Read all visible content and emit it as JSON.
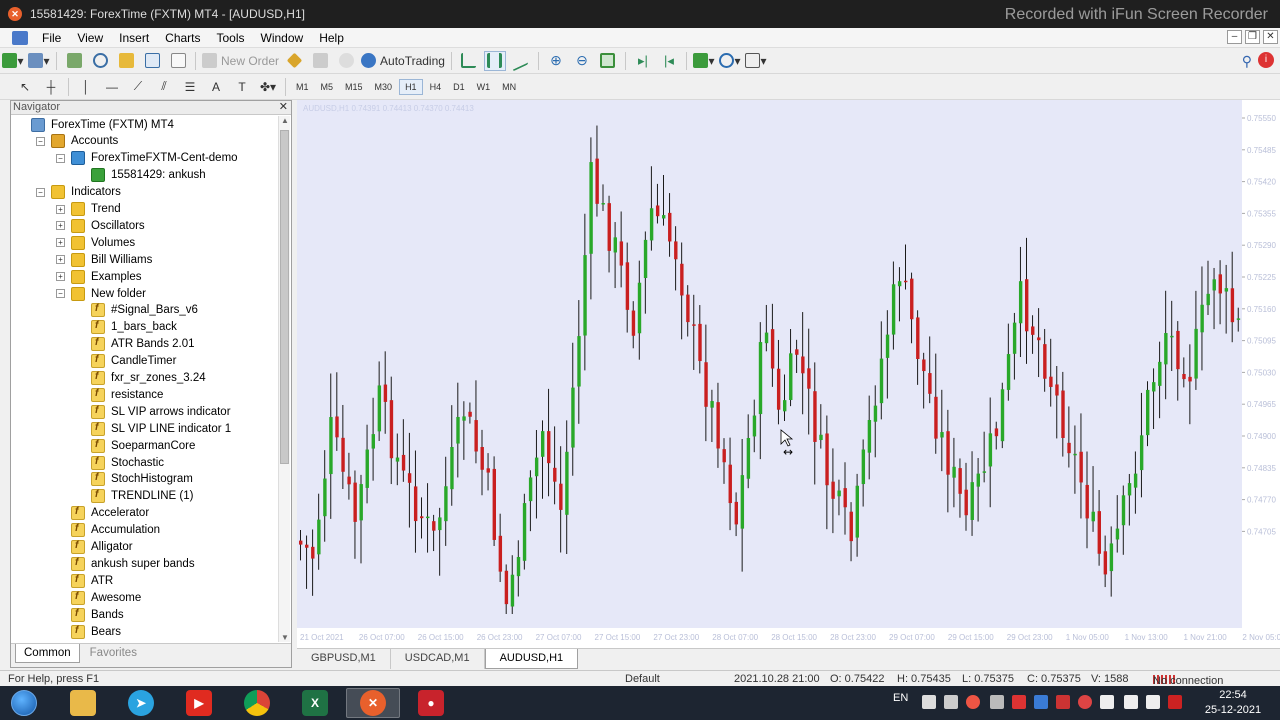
{
  "window": {
    "title": "15581429: ForexTime (FXTM) MT4 - [AUDUSD,H1]",
    "watermark": "Recorded with iFun Screen Recorder"
  },
  "menu": [
    "File",
    "View",
    "Insert",
    "Charts",
    "Tools",
    "Window",
    "Help"
  ],
  "toolbar": {
    "new_order_label": "New Order",
    "autotrading_label": "AutoTrading",
    "timeframes": [
      "M1",
      "M5",
      "M15",
      "M30",
      "H1",
      "H4",
      "D1",
      "W1",
      "MN"
    ],
    "active_timeframe": "H1"
  },
  "navigator": {
    "title": "Navigator",
    "tree": [
      {
        "level": 0,
        "icon": "terminal-icon",
        "label": "ForexTime (FXTM) MT4",
        "expander": ""
      },
      {
        "level": 1,
        "icon": "accounts-icon",
        "label": "Accounts",
        "expander": "−"
      },
      {
        "level": 2,
        "icon": "server-icon",
        "label": "ForexTimeFXTM-Cent-demo",
        "expander": "−"
      },
      {
        "level": 3,
        "icon": "user-icon",
        "label": "15581429: ankush",
        "expander": ""
      },
      {
        "level": 1,
        "icon": "folder-icon",
        "label": "Indicators",
        "expander": "−"
      },
      {
        "level": 2,
        "icon": "folder-icon",
        "label": "Trend",
        "expander": "+"
      },
      {
        "level": 2,
        "icon": "folder-icon",
        "label": "Oscillators",
        "expander": "+"
      },
      {
        "level": 2,
        "icon": "folder-icon",
        "label": "Volumes",
        "expander": "+"
      },
      {
        "level": 2,
        "icon": "folder-icon",
        "label": "Bill Williams",
        "expander": "+"
      },
      {
        "level": 2,
        "icon": "folder-icon",
        "label": "Examples",
        "expander": "+"
      },
      {
        "level": 2,
        "icon": "folder-icon",
        "label": "New folder",
        "expander": "−"
      },
      {
        "level": 3,
        "icon": "indicator-icon",
        "label": "#Signal_Bars_v6",
        "expander": ""
      },
      {
        "level": 3,
        "icon": "indicator-icon",
        "label": "1_bars_back",
        "expander": ""
      },
      {
        "level": 3,
        "icon": "indicator-icon",
        "label": "ATR Bands 2.01",
        "expander": ""
      },
      {
        "level": 3,
        "icon": "indicator-icon",
        "label": "CandleTimer",
        "expander": ""
      },
      {
        "level": 3,
        "icon": "indicator-icon",
        "label": "fxr_sr_zones_3.24",
        "expander": ""
      },
      {
        "level": 3,
        "icon": "indicator-icon",
        "label": "resistance",
        "expander": ""
      },
      {
        "level": 3,
        "icon": "indicator-icon",
        "label": "SL VIP arrows indicator",
        "expander": ""
      },
      {
        "level": 3,
        "icon": "indicator-icon",
        "label": "SL VIP LINE indicator 1",
        "expander": ""
      },
      {
        "level": 3,
        "icon": "indicator-icon",
        "label": "SoeparmanCore",
        "expander": ""
      },
      {
        "level": 3,
        "icon": "indicator-icon",
        "label": "Stochastic",
        "expander": ""
      },
      {
        "level": 3,
        "icon": "indicator-icon",
        "label": "StochHistogram",
        "expander": ""
      },
      {
        "level": 3,
        "icon": "indicator-icon",
        "label": "TRENDLINE (1)",
        "expander": ""
      },
      {
        "level": 2,
        "icon": "indicator-icon",
        "label": "Accelerator",
        "expander": ""
      },
      {
        "level": 2,
        "icon": "indicator-icon",
        "label": "Accumulation",
        "expander": ""
      },
      {
        "level": 2,
        "icon": "indicator-icon",
        "label": "Alligator",
        "expander": ""
      },
      {
        "level": 2,
        "icon": "indicator-icon",
        "label": "ankush super bands",
        "expander": ""
      },
      {
        "level": 2,
        "icon": "indicator-icon",
        "label": "ATR",
        "expander": ""
      },
      {
        "level": 2,
        "icon": "indicator-icon",
        "label": "Awesome",
        "expander": ""
      },
      {
        "level": 2,
        "icon": "indicator-icon",
        "label": "Bands",
        "expander": ""
      },
      {
        "level": 2,
        "icon": "indicator-icon",
        "label": "Bears",
        "expander": ""
      }
    ],
    "tabs": [
      "Common",
      "Favorites"
    ],
    "active_tab": "Common"
  },
  "chart": {
    "symbol_label": "AUDUSD,H1  0.74391 0.74413 0.74370 0.74413",
    "background": "#e6e8f8",
    "bull_color": "#29a829",
    "bear_color": "#c91f1f",
    "price_labels": [
      "0.75550",
      "0.75485",
      "0.75420",
      "0.75355",
      "0.75290",
      "0.75225",
      "0.75160",
      "0.75095",
      "0.75030",
      "0.74965",
      "0.74900",
      "0.74835",
      "0.74770",
      "0.74705"
    ],
    "time_labels": [
      "21 Oct 2021",
      "26 Oct 07:00",
      "26 Oct 15:00",
      "26 Oct 23:00",
      "27 Oct 07:00",
      "27 Oct 15:00",
      "27 Oct 23:00",
      "28 Oct 07:00",
      "28 Oct 15:00",
      "28 Oct 23:00",
      "29 Oct 07:00",
      "29 Oct 15:00",
      "29 Oct 23:00",
      "1 Nov 05:00",
      "1 Nov 13:00",
      "1 Nov 21:00",
      "2 Nov 05:00"
    ]
  },
  "chart_tabs": [
    "GBPUSD,M1",
    "USDCAD,M1",
    "AUDUSD,H1"
  ],
  "active_chart_tab": "AUDUSD,H1",
  "status": {
    "help": "For Help, press F1",
    "profile": "Default",
    "datetime": "2021.10.28 21:00",
    "open": "O: 0.75422",
    "high": "H: 0.75435",
    "low": "L: 0.75375",
    "close": "C: 0.75375",
    "volume": "V: 1588",
    "connection": "No connection"
  },
  "taskbar": {
    "apps": [
      "telegram-icon",
      "youtube-icon",
      "chrome-icon",
      "excel-icon",
      "mt4-icon",
      "recorder-icon"
    ],
    "language": "EN",
    "time": "22:54",
    "date": "25-12-2021"
  }
}
